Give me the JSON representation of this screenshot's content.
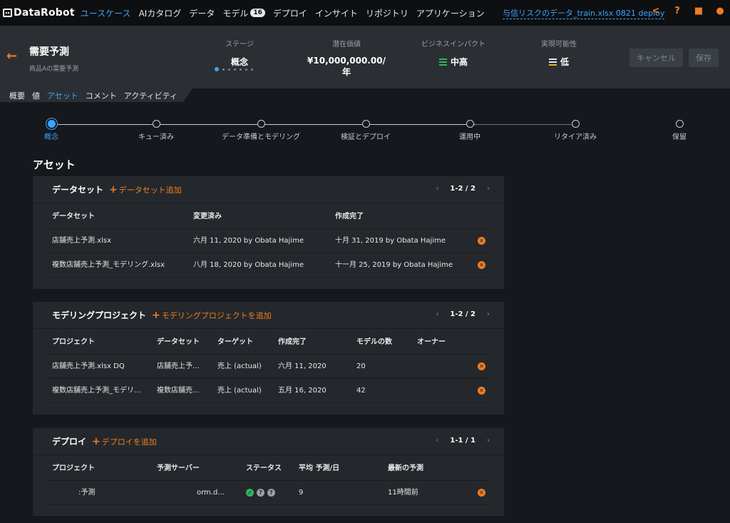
{
  "nav": {
    "logo": "DataRobot",
    "items": [
      "ユースケース",
      "AIカタログ",
      "データ",
      "モデル",
      "デプロイ",
      "インサイト",
      "リポジトリ",
      "アプリケーション"
    ],
    "model_badge": "16",
    "deploy_link": "与信リスクのデータ_train.xlsx 0821 deploy",
    "icons": [
      "share-icon",
      "help-icon",
      "folder-icon",
      "user-icon"
    ]
  },
  "header": {
    "title": "需要予測",
    "subtitle": "商品Aの需要予測",
    "stage_label": "ステージ",
    "stage_value": "概念",
    "potential_label": "潜在価値",
    "potential_value": "¥10,000,000.00/年",
    "impact_label": "ビジネスインパクト",
    "impact_value": "中高",
    "feasibility_label": "実現可能性",
    "feasibility_value": "低",
    "cancel": "キャンセル",
    "save": "保存"
  },
  "tabs": [
    "概要",
    "値",
    "アセット",
    "コメント",
    "アクティビティ"
  ],
  "stepper": [
    "概念",
    "キュー済み",
    "データ準備とモデリング",
    "検証とデプロイ",
    "運用中",
    "リタイア済み",
    "保留"
  ],
  "section_title": "アセット",
  "datasets": {
    "title": "データセット",
    "add": "データセット追加",
    "pager": "1-2 / 2",
    "headers": [
      "データセット",
      "変更済み",
      "作成完了"
    ],
    "rows": [
      [
        "店舗売上予測.xlsx",
        "六月 11, 2020 by Obata Hajime",
        "十月 31, 2019 by Obata Hajime"
      ],
      [
        "複数店舗売上予測_モデリング.xlsx",
        "八月 18, 2020 by Obata Hajime",
        "十一月 25, 2019 by Obata Hajime"
      ]
    ]
  },
  "projects": {
    "title": "モデリングプロジェクト",
    "add": "モデリングプロジェクトを追加",
    "pager": "1-2 / 2",
    "headers": [
      "プロジェクト",
      "データセット",
      "ターゲット",
      "作成完了",
      "モデルの数",
      "オーナー"
    ],
    "rows": [
      [
        "店舗売上予測.xlsx DQ",
        "店舗売上予...",
        "売上 (actual)",
        "六月 11, 2020",
        "20",
        ""
      ],
      [
        "複数店舗売上予測_モデリ...",
        "複数店舗売...",
        "売上 (actual)",
        "五月 16, 2020",
        "42",
        ""
      ]
    ]
  },
  "deployments": {
    "title": "デプロイ",
    "add": "デプロイを追加",
    "pager": "1-1 / 1",
    "headers": [
      "プロジェクト",
      "予測サーバー",
      "ステータス",
      "平均 予測/日",
      "最新の予測"
    ],
    "rows": [
      [
        ":予測",
        "orm.d...",
        "",
        "9",
        "11時間前"
      ]
    ]
  },
  "colors": {
    "accent": "#f07d22",
    "link": "#3aa5ff",
    "impact": "#2fb55b",
    "feasibility": "#e8b321"
  }
}
